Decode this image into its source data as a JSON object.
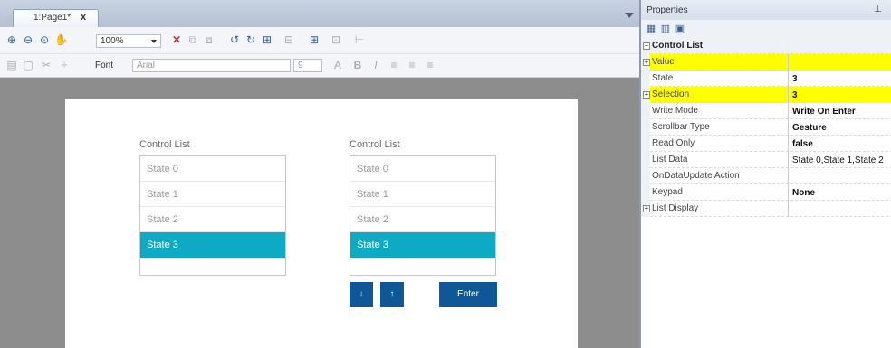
{
  "editor": {
    "tab_label": "1:Page1*",
    "tab_close": "x",
    "zoom_value": "100%",
    "font_label": "Font",
    "font_value": "Arial",
    "font_size_value": "9"
  },
  "canvas": {
    "list1": {
      "label": "Control List",
      "items": [
        "State 0",
        "State 1",
        "State 2",
        "State 3"
      ]
    },
    "list2": {
      "label": "Control List",
      "items": [
        "State 0",
        "State 1",
        "State 2",
        "State 3"
      ]
    },
    "buttons": {
      "down": "↓",
      "up": "↑",
      "enter": "Enter"
    }
  },
  "properties": {
    "title": "Properties",
    "rows": [
      {
        "name": "Control List",
        "value": ""
      },
      {
        "name": "Value",
        "value": ""
      },
      {
        "name": "State",
        "value": "3"
      },
      {
        "name": "Selection",
        "value": "3"
      },
      {
        "name": "Write Mode",
        "value": "Write On Enter"
      },
      {
        "name": "Scrollbar Type",
        "value": "Gesture"
      },
      {
        "name": "Read Only",
        "value": "false"
      },
      {
        "name": "List Data",
        "value": "State 0,State 1,State 2"
      },
      {
        "name": "OnDataUpdate Action",
        "value": ""
      },
      {
        "name": "Keypad",
        "value": "None"
      },
      {
        "name": "List Display",
        "value": ""
      }
    ]
  }
}
